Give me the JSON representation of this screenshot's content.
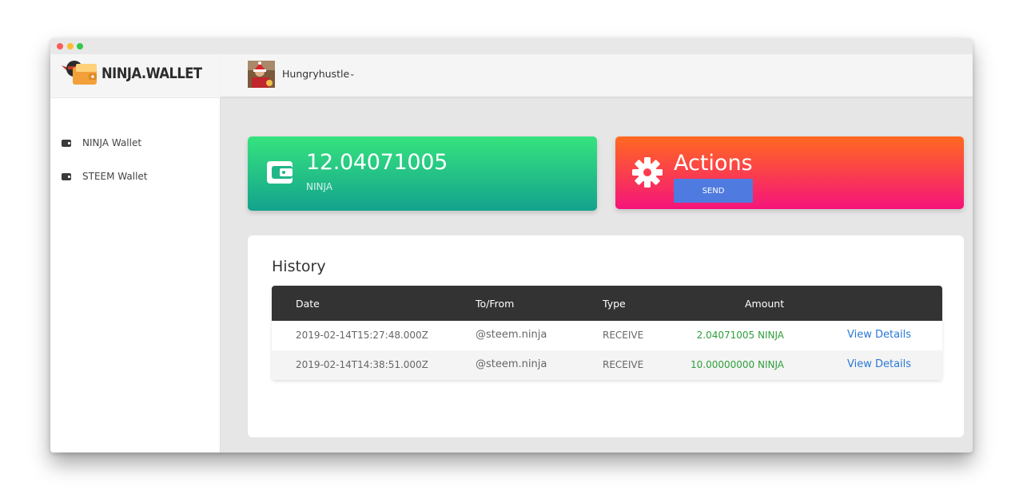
{
  "app": {
    "brand_name": "NINJA.WALLET",
    "accent_green": "#1fc087",
    "accent_orange": "#ff6a1f",
    "accent_pink": "#f5147a",
    "send_blue": "#4f7be0"
  },
  "sidebar": {
    "items": [
      {
        "label": "NINJA Wallet",
        "icon": "wallet-icon"
      },
      {
        "label": "STEEM Wallet",
        "icon": "wallet-icon"
      }
    ]
  },
  "header": {
    "user_name": "Hungryhustle",
    "chevron": "⌄"
  },
  "balance": {
    "value": "12.04071005",
    "unit": "NINJA"
  },
  "actions": {
    "title": "Actions",
    "send_label": "SEND"
  },
  "history": {
    "title": "History",
    "columns": [
      "Date",
      "To/From",
      "Type",
      "Amount"
    ],
    "rows": [
      {
        "date": "2019-02-14T15:27:48.000Z",
        "tofrom": "@steem.ninja",
        "type": "RECEIVE",
        "amount": "2.04071005 NINJA",
        "link": "View Details"
      },
      {
        "date": "2019-02-14T14:38:51.000Z",
        "tofrom": "@steem.ninja",
        "type": "RECEIVE",
        "amount": "10.00000000 NINJA",
        "link": "View Details"
      }
    ]
  }
}
